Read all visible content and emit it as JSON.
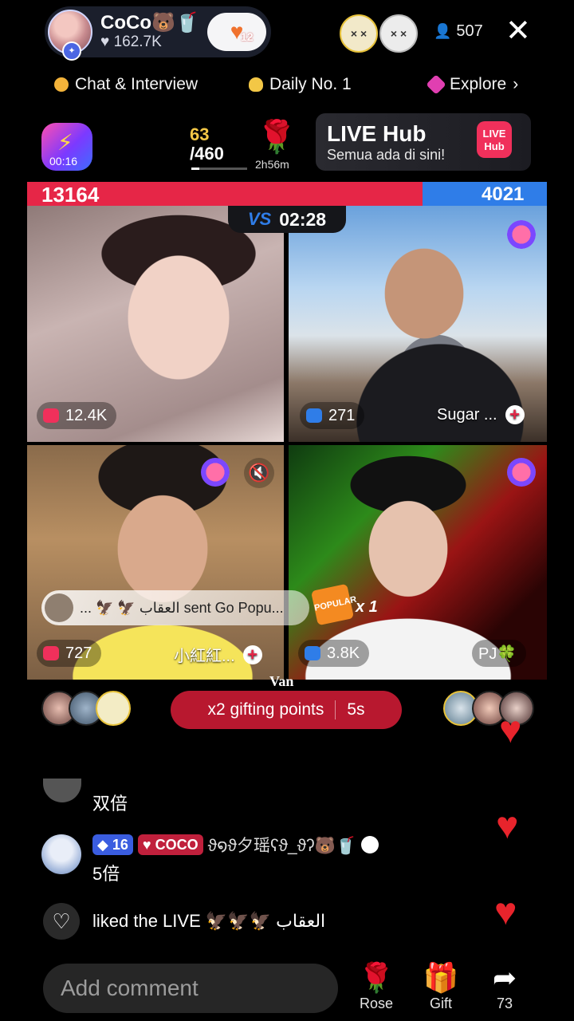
{
  "host": {
    "name": "CoCo🐻🥤",
    "likes": "162.7K",
    "follow_count": "12"
  },
  "viewers": {
    "face1_label": "× ×",
    "face2_label": "× ×",
    "count": "507"
  },
  "tabs": [
    {
      "label": "Chat & Interview",
      "color": "#f3b33a"
    },
    {
      "label": "Daily No. 1",
      "color": "#f3c746"
    },
    {
      "label": "Explore",
      "color": "#e03fb1"
    }
  ],
  "stats": {
    "badge_time": "00:16",
    "score_current": "63",
    "score_total": "/460",
    "score_progress": 0.14,
    "rose_time": "2h56m"
  },
  "live_hub": {
    "title": "LIVE Hub",
    "subtitle": "Semua ada di sini!",
    "logo_text": "LIVE Hub"
  },
  "battle": {
    "left_score": "13164",
    "right_score": "4021",
    "left_share": 0.76,
    "vs_label": "VS",
    "timer": "02:28"
  },
  "tiles": [
    {
      "count": "12.4K",
      "name": ""
    },
    {
      "count": "271",
      "name": "Sugar ..."
    },
    {
      "count": "727",
      "name": "小紅紅..."
    },
    {
      "count": "3.8K",
      "name": "PJ🍀"
    }
  ],
  "gift_banner": {
    "text": "... 🦅 🦅 العقاب sent Go Popu...",
    "gift_logo": "POPULAR",
    "multiplier": "x 1"
  },
  "van_label": "Van",
  "gifting": {
    "label": "x2 gifting points",
    "countdown": "5s"
  },
  "chat": [
    {
      "text": "双倍"
    },
    {
      "level": "16",
      "fan_badge": "COCO",
      "username": "ϑ໑ϑ夕瑶ʕϑ_ϑʔ🐻🥤",
      "text": "5倍"
    },
    {
      "text": "liked the LIVE 🦅🦅🦅 العقاب"
    }
  ],
  "bottom": {
    "comment_placeholder": "Add comment",
    "rose_label": "Rose",
    "gift_label": "Gift",
    "share_count": "73"
  }
}
